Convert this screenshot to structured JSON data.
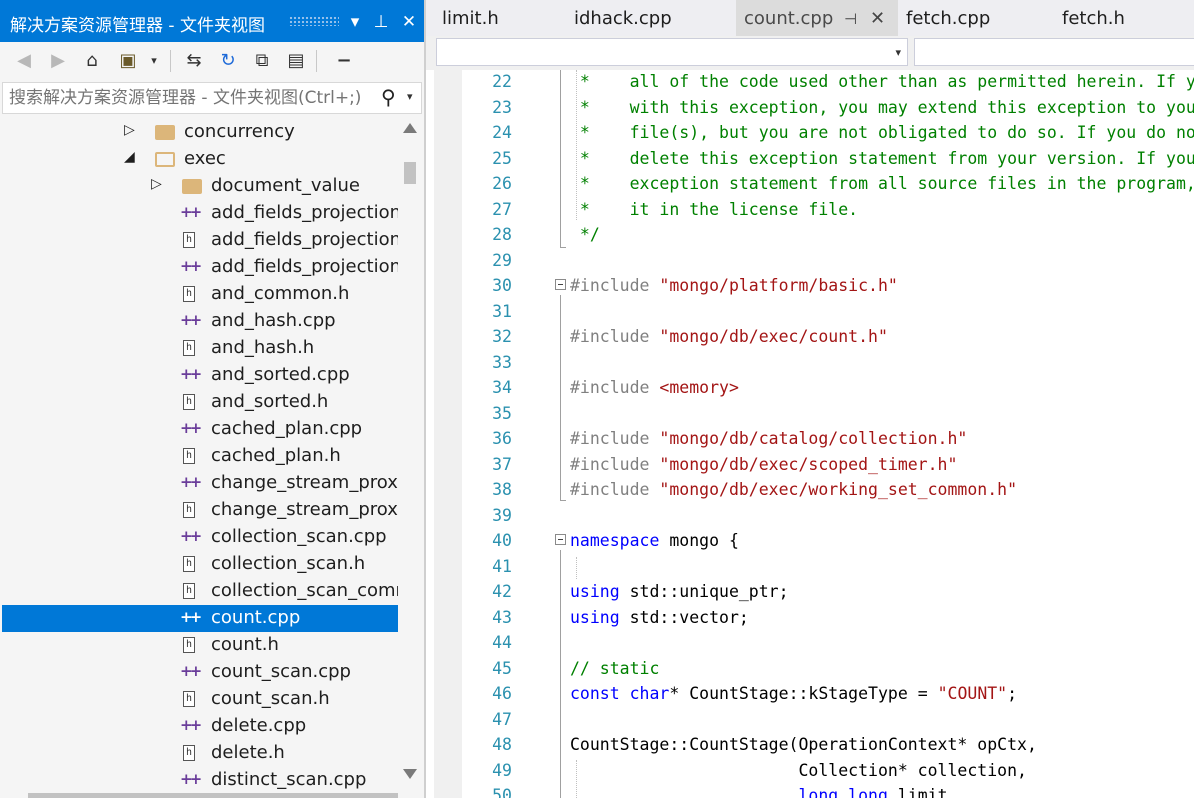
{
  "solution_explorer": {
    "title": "解决方案资源管理器 - 文件夹视图",
    "buttons": {
      "dropdown": "▾",
      "pin": "⊥",
      "close": "✕"
    },
    "search_placeholder": "搜索解决方案资源管理器 - 文件夹视图(Ctrl+;)",
    "tree": [
      {
        "label": "concurrency",
        "type": "folder",
        "state": "collapsed"
      },
      {
        "label": "exec",
        "type": "folder",
        "state": "expanded"
      },
      {
        "label": "document_value",
        "type": "folder",
        "state": "collapsed"
      },
      {
        "label": "add_fields_projection_",
        "type": "cpp"
      },
      {
        "label": "add_fields_projection_",
        "type": "h"
      },
      {
        "label": "add_fields_projection_",
        "type": "cpp"
      },
      {
        "label": "and_common.h",
        "type": "h"
      },
      {
        "label": "and_hash.cpp",
        "type": "cpp"
      },
      {
        "label": "and_hash.h",
        "type": "h"
      },
      {
        "label": "and_sorted.cpp",
        "type": "cpp"
      },
      {
        "label": "and_sorted.h",
        "type": "h"
      },
      {
        "label": "cached_plan.cpp",
        "type": "cpp"
      },
      {
        "label": "cached_plan.h",
        "type": "h"
      },
      {
        "label": "change_stream_proxy",
        "type": "cpp"
      },
      {
        "label": "change_stream_proxy",
        "type": "h"
      },
      {
        "label": "collection_scan.cpp",
        "type": "cpp"
      },
      {
        "label": "collection_scan.h",
        "type": "h"
      },
      {
        "label": "collection_scan_comm",
        "type": "h"
      },
      {
        "label": "count.cpp",
        "type": "cpp",
        "selected": true
      },
      {
        "label": "count.h",
        "type": "h"
      },
      {
        "label": "count_scan.cpp",
        "type": "cpp"
      },
      {
        "label": "count_scan.h",
        "type": "h"
      },
      {
        "label": "delete.cpp",
        "type": "cpp"
      },
      {
        "label": "delete.h",
        "type": "h"
      },
      {
        "label": "distinct_scan.cpp",
        "type": "cpp"
      }
    ]
  },
  "editor": {
    "tabs": [
      {
        "label": "limit.h",
        "active": false
      },
      {
        "label": "idhack.cpp",
        "active": false
      },
      {
        "label": "count.cpp",
        "active": true
      },
      {
        "label": "fetch.cpp",
        "active": false
      },
      {
        "label": "fetch.h",
        "active": false
      }
    ],
    "lines": [
      {
        "n": "22",
        "text": " *    all of the code used other than as permitted herein. If y",
        "cls": "comment"
      },
      {
        "n": "23",
        "text": " *    with this exception, you may extend this exception to you",
        "cls": "comment"
      },
      {
        "n": "24",
        "text": " *    file(s), but you are not obligated to do so. If you do no",
        "cls": "comment"
      },
      {
        "n": "25",
        "text": " *    delete this exception statement from your version. If you",
        "cls": "comment"
      },
      {
        "n": "26",
        "text": " *    exception statement from all source files in the program,",
        "cls": "comment"
      },
      {
        "n": "27",
        "text": " *    it in the license file.",
        "cls": "comment"
      },
      {
        "n": "28",
        "text": " */",
        "cls": "comment"
      },
      {
        "n": "29",
        "text": ""
      },
      {
        "n": "30",
        "pp": "#include ",
        "str": "\"mongo/platform/basic.h\"",
        "fold": true
      },
      {
        "n": "31",
        "text": ""
      },
      {
        "n": "32",
        "pp": "#include ",
        "str": "\"mongo/db/exec/count.h\""
      },
      {
        "n": "33",
        "text": ""
      },
      {
        "n": "34",
        "pp": "#include ",
        "str": "<memory>"
      },
      {
        "n": "35",
        "text": ""
      },
      {
        "n": "36",
        "pp": "#include ",
        "str": "\"mongo/db/catalog/collection.h\""
      },
      {
        "n": "37",
        "pp": "#include ",
        "str": "\"mongo/db/exec/scoped_timer.h\""
      },
      {
        "n": "38",
        "pp": "#include ",
        "str": "\"mongo/db/exec/working_set_common.h\""
      },
      {
        "n": "39",
        "text": ""
      },
      {
        "n": "40",
        "kw": "namespace",
        "rest": " mongo {",
        "fold": true
      },
      {
        "n": "41",
        "text": ""
      },
      {
        "n": "42",
        "kw": "using",
        "rest": " std::unique_ptr;"
      },
      {
        "n": "43",
        "kw": "using",
        "rest": " std::vector;"
      },
      {
        "n": "44",
        "text": ""
      },
      {
        "n": "45",
        "text": "// static",
        "cls": "comment"
      },
      {
        "n": "46",
        "kw": "const",
        "rest": " ",
        "kw2": "char",
        "rest2": "* CountStage::kStageType = ",
        "str": "\"COUNT\"",
        "tail": ";"
      },
      {
        "n": "47",
        "text": ""
      },
      {
        "n": "48",
        "text": "CountStage::CountStage(OperationContext* opCtx,"
      },
      {
        "n": "49",
        "text": "                       Collection* collection,"
      },
      {
        "n": "50",
        "text": "                       ",
        "kw": "long",
        "rest": " ",
        "kw2": "long",
        "rest2": " limit,"
      }
    ]
  }
}
